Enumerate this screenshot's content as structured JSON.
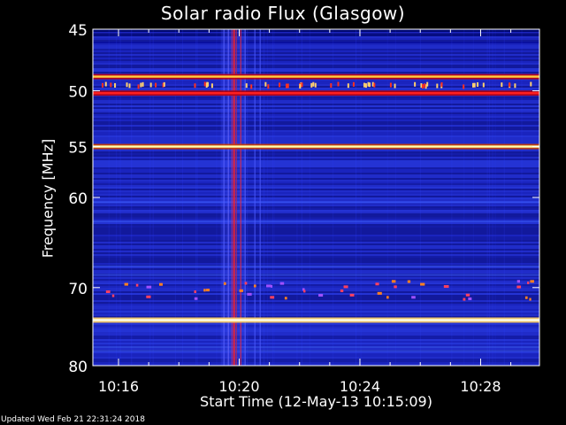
{
  "chart_data": {
    "type": "heatmap",
    "title": "Solar radio Flux (Glasgow)",
    "xlabel": "Start Time (12-May-13 10:15:09)",
    "ylabel": "Frequency [MHz]",
    "x_ticks": [
      "10:16",
      "10:20",
      "10:24",
      "10:28"
    ],
    "x_tick_minutes": [
      0.85,
      4.85,
      8.85,
      12.85
    ],
    "xlim_minutes": [
      0,
      14.8
    ],
    "y_ticks": [
      45,
      50,
      55,
      60,
      70,
      80
    ],
    "ylim": [
      45,
      80
    ],
    "y_scale": "log",
    "colormap": "blue-red-yellow-white",
    "bright_bands_mhz": [
      {
        "freq": 48.8,
        "level": "red-yellow"
      },
      {
        "freq": 50.2,
        "level": "red"
      },
      {
        "freq": 55.0,
        "level": "yellow-white"
      },
      {
        "freq": 74.0,
        "level": "white"
      }
    ],
    "bursts_time": [
      "10:20",
      "10:20"
    ],
    "grid": false
  },
  "footer": "Updated Wed Feb 21 22:31:24 2018"
}
